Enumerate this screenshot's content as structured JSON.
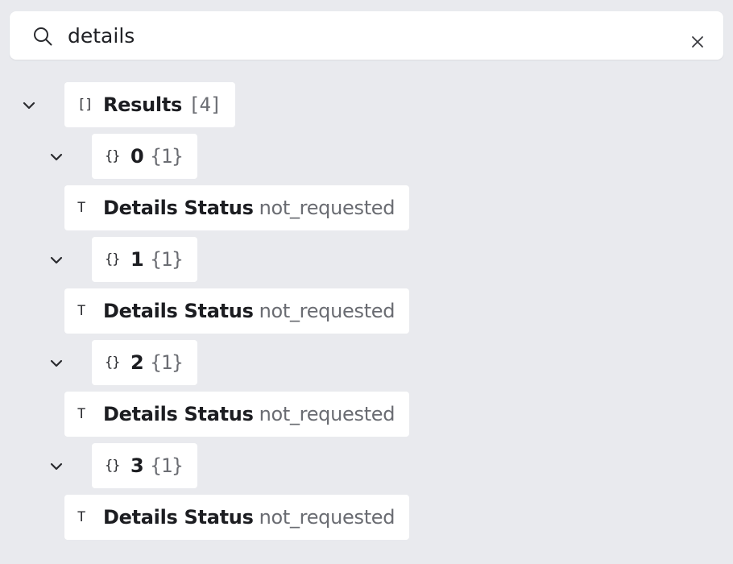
{
  "search": {
    "value": "details"
  },
  "icons": {
    "search": "search-icon",
    "clear": "close-icon",
    "expand": "chevron-down-icon",
    "array": "array-bracket-icon",
    "object": "object-brace-icon",
    "text": "text-type-icon"
  },
  "tree": {
    "root": {
      "type_glyph": "[]",
      "key": "Results",
      "count": "[4]"
    },
    "items": [
      {
        "type_glyph": "{}",
        "key": "0",
        "count": "{1}",
        "field": {
          "type_glyph": "T",
          "key": "Details Status",
          "value": "not_requested"
        }
      },
      {
        "type_glyph": "{}",
        "key": "1",
        "count": "{1}",
        "field": {
          "type_glyph": "T",
          "key": "Details Status",
          "value": "not_requested"
        }
      },
      {
        "type_glyph": "{}",
        "key": "2",
        "count": "{1}",
        "field": {
          "type_glyph": "T",
          "key": "Details Status",
          "value": "not_requested"
        }
      },
      {
        "type_glyph": "{}",
        "key": "3",
        "count": "{1}",
        "field": {
          "type_glyph": "T",
          "key": "Details Status",
          "value": "not_requested"
        }
      }
    ]
  },
  "colors": {
    "background": "#e9eaee",
    "node_background": "#ffffff",
    "key_text": "#1c1d21",
    "muted_text": "#6a6c72"
  }
}
